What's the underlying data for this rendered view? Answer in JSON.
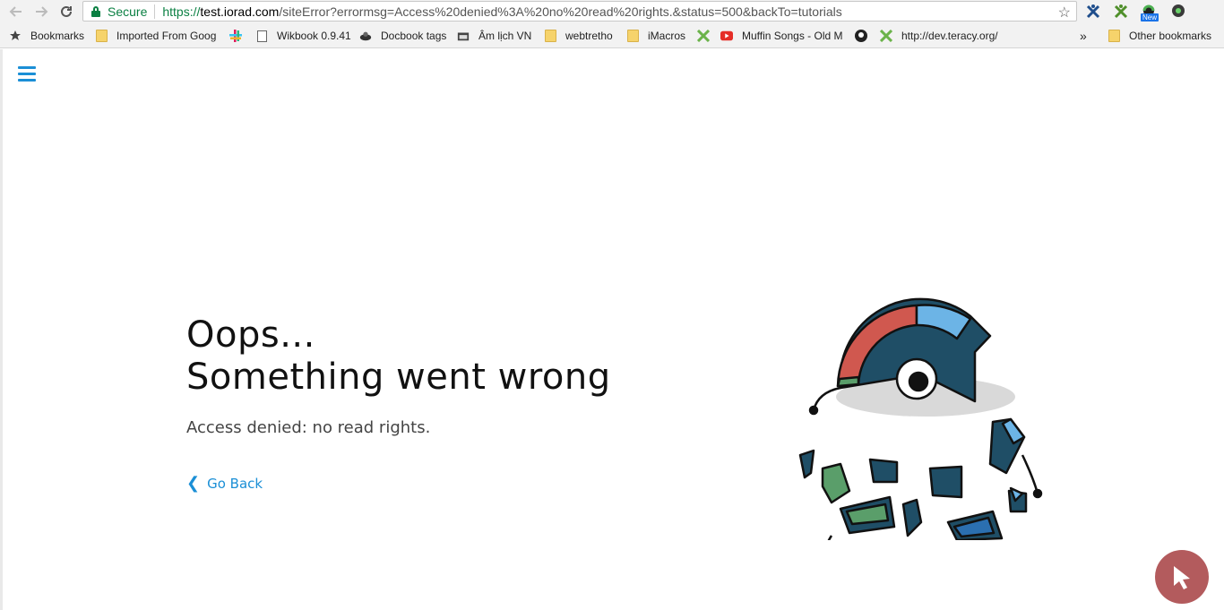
{
  "browser": {
    "nav": {
      "back_icon": "arrow-left-icon",
      "forward_icon": "arrow-right-icon",
      "reload_icon": "reload-icon"
    },
    "security_label": "Secure",
    "url": {
      "scheme": "https://",
      "host": "test.iorad.com",
      "path": "/siteError?errormsg=Access%20denied%3A%20no%20read%20rights.&status=500&backTo=tutorials"
    },
    "new_badge": "New",
    "bookmarks": [
      {
        "label": "Bookmarks",
        "icon": "star-icon"
      },
      {
        "label": "Imported From Goog",
        "icon": "folder-icon"
      },
      {
        "label": "",
        "icon": "slack-icon"
      },
      {
        "label": "Wikbook 0.9.41",
        "icon": "page-icon"
      },
      {
        "label": "Docbook tags",
        "icon": "docbook-icon"
      },
      {
        "label": "Âm lịch VN",
        "icon": "calendar-icon"
      },
      {
        "label": "webtretho",
        "icon": "folder-icon"
      },
      {
        "label": "iMacros",
        "icon": "folder-icon"
      },
      {
        "label": "",
        "icon": "xuggle-icon"
      },
      {
        "label": "Muffin Songs - Old M",
        "icon": "youtube-icon"
      },
      {
        "label": "",
        "icon": "github-icon"
      },
      {
        "label": "http://dev.teracy.org/",
        "icon": "xuggle-icon"
      }
    ],
    "overflow_label": "»",
    "other_bookmarks": "Other bookmarks"
  },
  "page": {
    "menu_icon": "hamburger-icon",
    "heading_line1": "Oops...",
    "heading_line2": "Something went wrong",
    "message": "Access denied: no read rights.",
    "back_label": "Go Back",
    "colors": {
      "accent": "#1b8fd6",
      "fab": "#b35b5d",
      "dark": "#1f4e66",
      "red": "#d0584f",
      "blue": "#6cb4e6",
      "green": "#5a9e6a"
    }
  }
}
